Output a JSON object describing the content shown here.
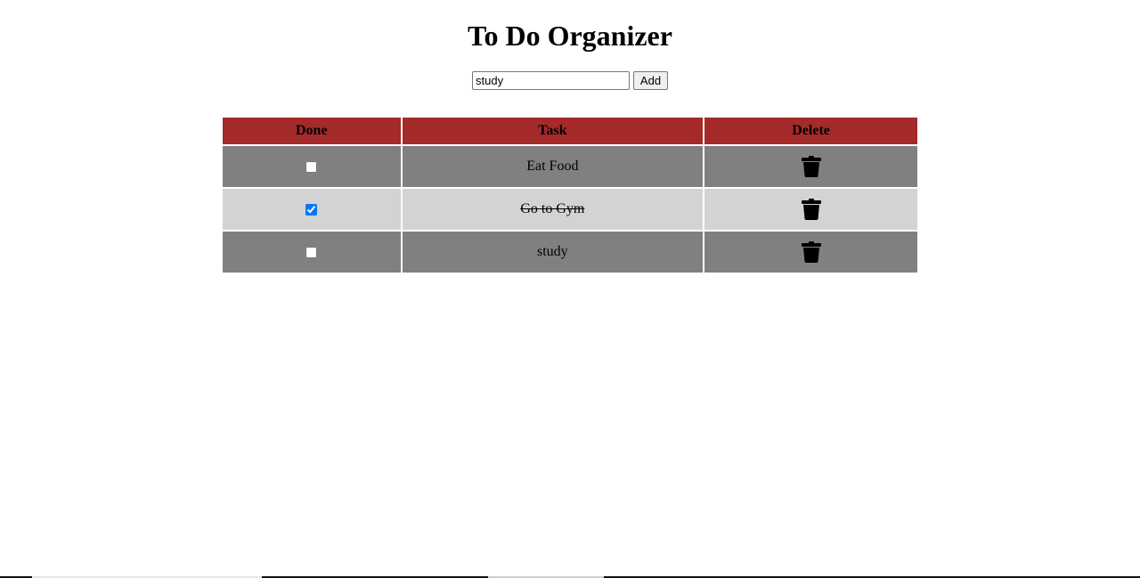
{
  "title": "To Do Organizer",
  "add_form": {
    "input_value": "study",
    "button_label": "Add"
  },
  "table": {
    "headers": {
      "done": "Done",
      "task": "Task",
      "delete": "Delete"
    },
    "rows": [
      {
        "done": false,
        "task": "Eat Food",
        "delete_icon": "trash-icon"
      },
      {
        "done": true,
        "task": "Go to Gym",
        "delete_icon": "trash-icon"
      },
      {
        "done": false,
        "task": "study",
        "delete_icon": "trash-icon"
      }
    ]
  },
  "colors": {
    "header_bg": "#a52a2a",
    "row_dark": "#808080",
    "row_light": "#d3d3d3"
  }
}
